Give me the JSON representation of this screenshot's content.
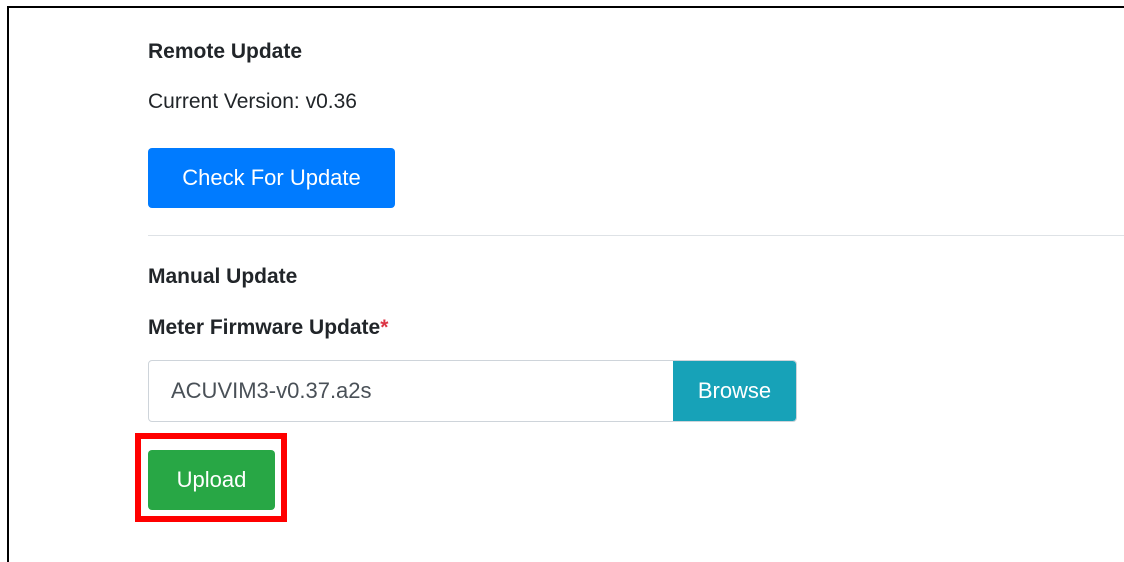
{
  "remote_update": {
    "title": "Remote Update",
    "current_version": "Current Version: v0.36",
    "check_button_label": "Check For Update"
  },
  "manual_update": {
    "title": "Manual Update",
    "field_label": "Meter Firmware Update",
    "required_marker": "*",
    "file_name": "ACUVIM3-v0.37.a2s",
    "browse_label": "Browse",
    "upload_label": "Upload"
  },
  "colors": {
    "primary": "#007bff",
    "info": "#17a2b8",
    "success": "#28a745",
    "danger": "#dc3545",
    "highlight": "#ff0000"
  }
}
